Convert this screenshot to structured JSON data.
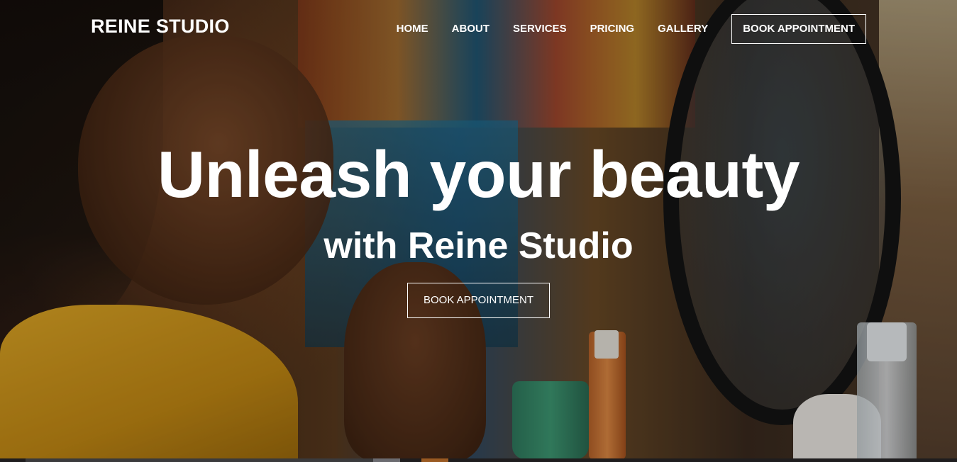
{
  "site": {
    "logo": "REINE STUDIO"
  },
  "nav": {
    "items": [
      {
        "label": "HOME"
      },
      {
        "label": "ABOUT"
      },
      {
        "label": "SERVICES"
      },
      {
        "label": "PRICING"
      },
      {
        "label": "GALLERY"
      }
    ],
    "cta_label": "BOOK APPOINTMENT"
  },
  "hero": {
    "headline": "Unleash your beauty",
    "subheadline": "with Reine Studio",
    "cta_label": "BOOK APPOINTMENT"
  },
  "colors": {
    "text": "#ffffff",
    "shirt_accent": "#e0a826"
  }
}
